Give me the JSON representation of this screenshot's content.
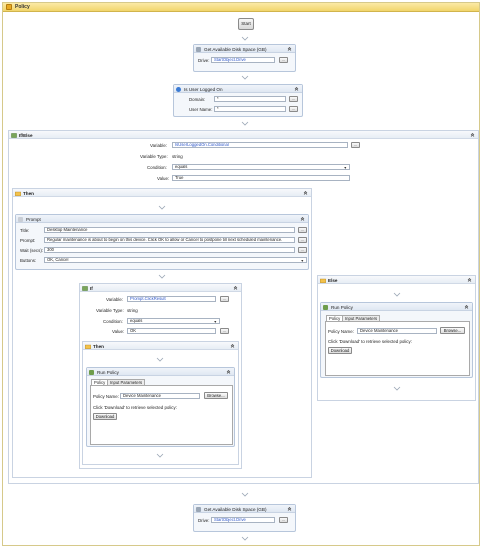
{
  "policy": {
    "title": "Policy"
  },
  "start": {
    "label": "Start"
  },
  "disk_space_top": {
    "title": "Get Available Disk Space (GB)",
    "drive_label": "Drive:",
    "drive_value": "StartObject.Drive",
    "browse": "..."
  },
  "is_user_logged_on": {
    "title": "Is User Logged On",
    "domain_label": "Domain:",
    "domain_value": "*",
    "username_label": "User Name:",
    "username_value": "*",
    "browse": "..."
  },
  "ifelse": {
    "title": "If/Else",
    "variable_label": "Variable:",
    "variable_value": "IsUserLoggedOn.Conditional",
    "variable_type_label": "Variable Type:",
    "variable_type_value": "string",
    "condition_label": "Condition:",
    "condition_value": "equals",
    "value_label": "Value:",
    "value_value": "True",
    "browse": "..."
  },
  "then_outer": {
    "title": "Then"
  },
  "prompt": {
    "title": "Prompt",
    "title_label": "Title:",
    "title_value": "Desktop Maintenance",
    "prompt_label": "Prompt:",
    "prompt_value": "Regular maintenance is about to begin on this device.  Click OK to allow or Cancel to postpone till next scheduled maintenance.",
    "wait_label": "Wait (secs):",
    "wait_value": "300",
    "buttons_label": "Buttons:",
    "buttons_value": "OK, Cancel",
    "browse": "..."
  },
  "if_inner": {
    "title": "If",
    "variable_label": "Variable:",
    "variable_value": "Prompt.ClickResult",
    "variable_type_label": "Variable Type:",
    "variable_type_value": "string",
    "condition_label": "Condition:",
    "condition_value": "equals",
    "value_label": "Value:",
    "value_value": "OK",
    "browse": "..."
  },
  "then_inner": {
    "title": "Then"
  },
  "run_policy_inner": {
    "title": "Run Policy",
    "tab_policy": "Policy",
    "tab_input": "Input Parameters",
    "policy_name_label": "Policy Name:",
    "policy_name_value": "Device Maintenance",
    "browse_label": "Browse...",
    "hint": "Click 'Download' to retrieve selected policy:",
    "download_label": "Download"
  },
  "else": {
    "title": "Else"
  },
  "run_policy_else": {
    "title": "Run Policy",
    "tab_policy": "Policy",
    "tab_input": "Input Parameters",
    "policy_name_label": "Policy Name:",
    "policy_name_value": "Device Maintenance",
    "browse_label": "Browse...",
    "hint": "Click 'Download' to retrieve selected policy:",
    "download_label": "Download"
  },
  "disk_space_bottom": {
    "title": "Get Available Disk Space (GB)",
    "drive_label": "Drive:",
    "drive_value": "StartObject.Drive",
    "browse": "..."
  },
  "colors": {
    "policy_header": "#f1d56b",
    "box_border": "#b7c6db",
    "link_blue": "#2d56c8"
  }
}
